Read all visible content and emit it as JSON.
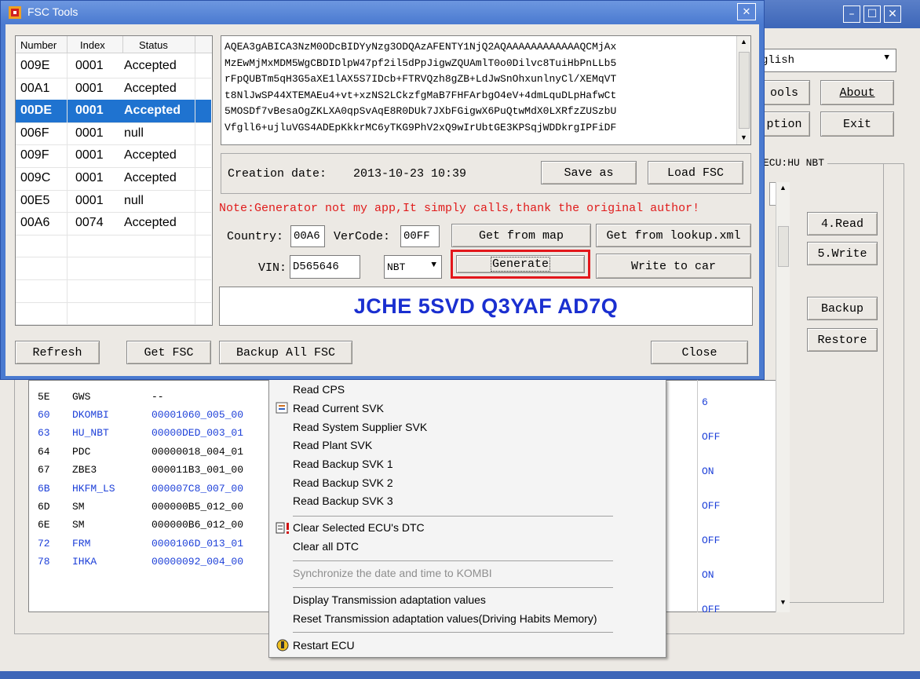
{
  "fsc_window": {
    "title": "FSC Tools",
    "list_headers": [
      "Number",
      "Index",
      "Status"
    ],
    "fsc_list": [
      {
        "number": "009E",
        "index": "0001",
        "status": "Accepted"
      },
      {
        "number": "00A1",
        "index": "0001",
        "status": "Accepted"
      },
      {
        "number": "00DE",
        "index": "0001",
        "status": "Accepted",
        "selected": true
      },
      {
        "number": "006F",
        "index": "0001",
        "status": "null"
      },
      {
        "number": "009F",
        "index": "0001",
        "status": "Accepted"
      },
      {
        "number": "009C",
        "index": "0001",
        "status": "Accepted"
      },
      {
        "number": "00E5",
        "index": "0001",
        "status": "null"
      },
      {
        "number": "00A6",
        "index": "0074",
        "status": "Accepted"
      }
    ],
    "fsc_text_lines": [
      "AQEA3gABICA3NzM0ODcBIDYyNzg3ODQAzAFENTY1NjQ2AQAAAAAAAAAAAAQCMjAx",
      "MzEwMjMxMDM5WgCBDIDlpW47pf2il5dPpJigwZQUAmlT0o0Dilvc8TuiHbPnLLb5",
      "rFpQUBTm5qH3G5aXE1lAX5S7IDcb+FTRVQzh8gZB+LdJwSnOhxunlnyCl/XEMqVT",
      "t8NlJwSP44XTEMAEu4+vt+xzNS2LCkzfgMaB7FHFArbgO4eV+4dmLquDLpHafwCt",
      "5MOSDf7vBesaOgZKLXA0qpSvAqE8R0DUk7JXbFGigwX6PuQtwMdX0LXRfzZUSzbU",
      "Vfgll6+ujluVGS4ADEpKkkrMC6yTKG9PhV2xQ9wIrUbtGE3KPSqjWDDkrgIPFiDF"
    ],
    "creation_date_label": "Creation date:",
    "creation_date_value": "2013-10-23 10:39",
    "save_as_label": "Save as",
    "load_fsc_label": "Load FSC",
    "note_text": "Note:Generator not my app,It simply calls,thank the original author!",
    "country_label": "Country:",
    "country_value": "00A6",
    "vercode_label": "VerCode:",
    "vercode_value": "00FF",
    "get_from_map_label": "Get from map",
    "get_from_lookup_label": "Get from lookup.xml",
    "vin_label": "VIN:",
    "vin_value": "D565646",
    "model_select_value": "NBT",
    "generate_label": "Generate",
    "write_to_car_label": "Write to car",
    "generated_code": "JCHE 5SVD Q3YAF AD7Q",
    "refresh_label": "Refresh",
    "get_fsc_label": "Get FSC",
    "backup_all_label": "Backup All FSC",
    "close_label": "Close"
  },
  "main_window": {
    "language_value": "glish",
    "tools_label": "ools",
    "about_label": "About",
    "option_label": "ption",
    "exit_label": "Exit",
    "ecu_group_label": "ECU:HU NBT",
    "read_label": "4.Read",
    "write_label": "5.Write",
    "backup_label": "Backup",
    "restore_label": "Restore",
    "ecu_rows": [
      {
        "addr": "5E",
        "name": "GWS",
        "svk": "--",
        "blue": false
      },
      {
        "addr": "60",
        "name": "DKOMBI",
        "svk": "00001060_005_00",
        "blue": true
      },
      {
        "addr": "63",
        "name": "HU_NBT",
        "svk": "00000DED_003_01",
        "blue": true
      },
      {
        "addr": "64",
        "name": "PDC",
        "svk": "00000018_004_01",
        "blue": false
      },
      {
        "addr": "67",
        "name": "ZBE3",
        "svk": "000011B3_001_00",
        "blue": false
      },
      {
        "addr": "6B",
        "name": "HKFM_LS",
        "svk": "000007C8_007_00",
        "blue": true
      },
      {
        "addr": "6D",
        "name": "SM",
        "svk": "000000B5_012_00",
        "blue": false
      },
      {
        "addr": "6E",
        "name": "SM",
        "svk": "000000B6_012_00",
        "blue": false
      },
      {
        "addr": "72",
        "name": "FRM",
        "svk": "0000106D_013_01",
        "blue": true
      },
      {
        "addr": "78",
        "name": "IHKA",
        "svk": "00000092_004_00",
        "blue": true
      }
    ],
    "value_column": [
      "6",
      "OFF",
      "ON",
      "OFF",
      "OFF",
      "ON",
      "OFF"
    ]
  },
  "context_menu": {
    "items": [
      "Read CPS",
      "Read Current SVK",
      "Read System Supplier SVK",
      "Read Plant SVK",
      "Read Backup SVK 1",
      "Read Backup SVK 2",
      "Read Backup SVK 3",
      "Clear Selected ECU's DTC",
      "Clear all DTC",
      "Synchronize the date and time to KOMBI",
      "Display Transmission adaptation values",
      "Reset Transmission adaptation values(Driving Habits Memory)",
      "Restart ECU"
    ]
  },
  "colors": {
    "title_blue": "#4a7ad0",
    "selection_blue": "#1f73d0",
    "note_red": "#e01b1b",
    "code_blue": "#1a2fd0",
    "highlight_red": "#e3161b",
    "ecu_blue": "#1c3fd8"
  }
}
